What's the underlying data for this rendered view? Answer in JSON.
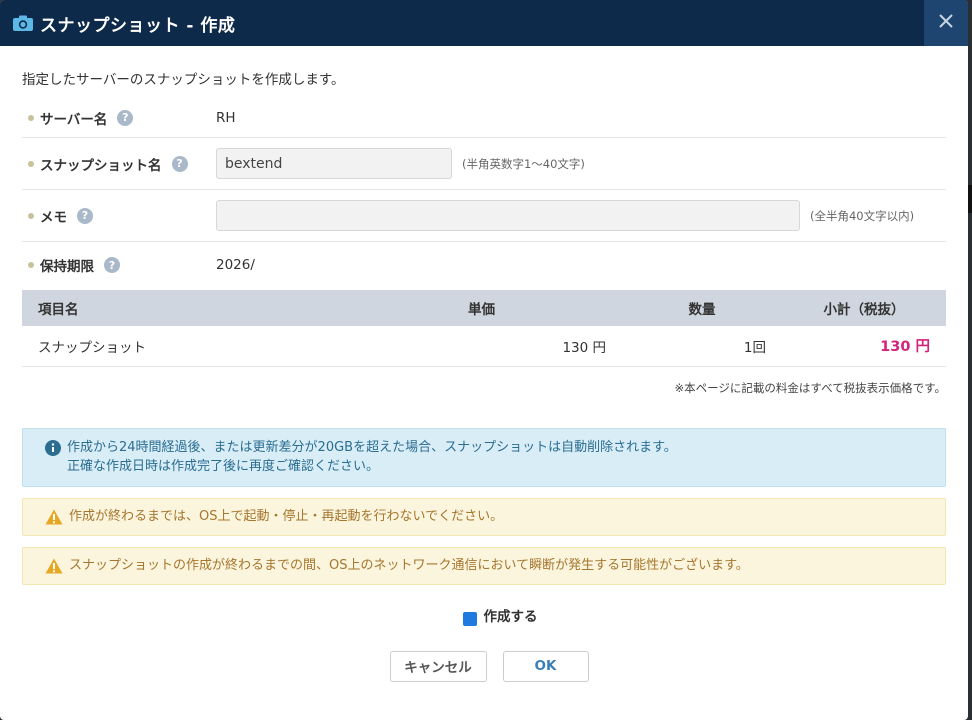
{
  "dialog": {
    "title": "スナップショット - 作成",
    "title_icon": "camera-icon",
    "close_icon": "close-icon"
  },
  "intro": "指定したサーバーのスナップショットを作成します。",
  "form": {
    "server_name": {
      "label": "サーバー名",
      "value": "RH"
    },
    "snapshot_name": {
      "label": "スナップショット名",
      "value": "bextend",
      "hint": "(半角英数字1～40文字)"
    },
    "memo": {
      "label": "メモ",
      "value": "",
      "hint": "(全半角40文字以内)"
    },
    "retention": {
      "label": "保持期限",
      "value": "2026/"
    },
    "help_glyph": "?"
  },
  "price_table": {
    "headers": {
      "item": "項目名",
      "unit": "単価",
      "qty": "数量",
      "subtotal": "小計（税抜）"
    },
    "rows": [
      {
        "item": "スナップショット",
        "unit": "130 円",
        "qty": "1回",
        "subtotal": "130 円"
      }
    ]
  },
  "tax_note": "※本ページに記載の料金はすべて税抜表示価格です。",
  "alerts": {
    "info_line1": "作成から24時間経過後、または更新差分が20GBを超えた場合、スナップショットは自動削除されます。",
    "info_line2": "正確な作成日時は作成完了後に再度ご確認ください。",
    "warn1": "作成が終わるまでは、OS上で起動・停止・再起動を行わないでください。",
    "warn2": "スナップショットの作成が終わるまでの間、OS上のネットワーク通信において瞬断が発生する可能性がございます。"
  },
  "confirm": {
    "label": "作成する",
    "checked": true
  },
  "buttons": {
    "cancel": "キャンセル",
    "ok": "OK"
  },
  "colors": {
    "titlebar": "#0e2a4b",
    "close_button": "#1e4570",
    "subtotal": "#d4237a",
    "checkbox": "#1f7ae0"
  }
}
